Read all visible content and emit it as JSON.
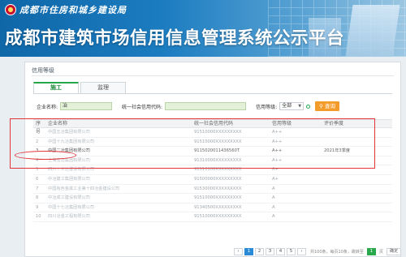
{
  "header": {
    "org_name": "成都市住房和城乡建设局",
    "title": "成都市建筑市场信用信息管理系统公示平台"
  },
  "section": {
    "title": "信用等级"
  },
  "tabs": [
    {
      "label": "施工",
      "active": true
    },
    {
      "label": "监理",
      "active": false
    }
  ],
  "filter": {
    "company_label": "企业名称:",
    "company_value": "冶",
    "credit_code_label": "统一社会信用代码:",
    "credit_code_value": "",
    "level_label": "信用等级:",
    "level_value": "全部",
    "search_label": "查询"
  },
  "table": {
    "headers": [
      "序号",
      "企业名称",
      "统一社会信用代码",
      "信用等级",
      "评价季度"
    ],
    "rows": [
      {
        "no": "1",
        "name": "中国五冶集团有限公司",
        "code": "91510000XXXXXXXXX",
        "level": "A++",
        "year": ""
      },
      {
        "no": "2",
        "name": "中国十九冶集团有限公司",
        "code": "91510000XXXXXXXXX",
        "level": "A++",
        "year": ""
      },
      {
        "no": "3",
        "name": "中国二冶集团有限公司",
        "code": "9115020011436560T",
        "level": "A++",
        "year": "2021年3季度"
      },
      {
        "no": "4",
        "name": "上海宝冶集团有限公司",
        "code": "91310000XXXXXXXXX",
        "level": "A++",
        "year": ""
      },
      {
        "no": "5",
        "name": "四川十三冶建设有限公司",
        "code": "91510100XXXXXXXXX",
        "level": "A+",
        "year": ""
      },
      {
        "no": "6",
        "name": "中冶建工集团有限公司",
        "code": "91500000XXXXXXXXX",
        "level": "A+",
        "year": ""
      },
      {
        "no": "7",
        "name": "中国有色金属工业第十四冶金建设公司",
        "code": "91530000XXXXXXXXX",
        "level": "A",
        "year": ""
      },
      {
        "no": "8",
        "name": "中冶成工建设有限公司",
        "code": "91510000XXXXXXXXX",
        "level": "A",
        "year": ""
      },
      {
        "no": "9",
        "name": "中国十七冶集团有限公司",
        "code": "91340500XXXXXXXXX",
        "level": "A",
        "year": ""
      },
      {
        "no": "10",
        "name": "四川冶金工程有限公司",
        "code": "91510000XXXXXXXXX",
        "level": "A",
        "year": ""
      }
    ]
  },
  "pager": {
    "pages": [
      "1",
      "2",
      "3",
      "4",
      "5"
    ],
    "info": "共100条，每页10条，跳转至",
    "jump_value": "1",
    "go_label": "页",
    "confirm_label": "确定"
  },
  "colors": {
    "banner": "#1b7cc0",
    "active_tab": "#27a74a",
    "search_button": "#f39c2b",
    "highlight": "#e2343a"
  }
}
